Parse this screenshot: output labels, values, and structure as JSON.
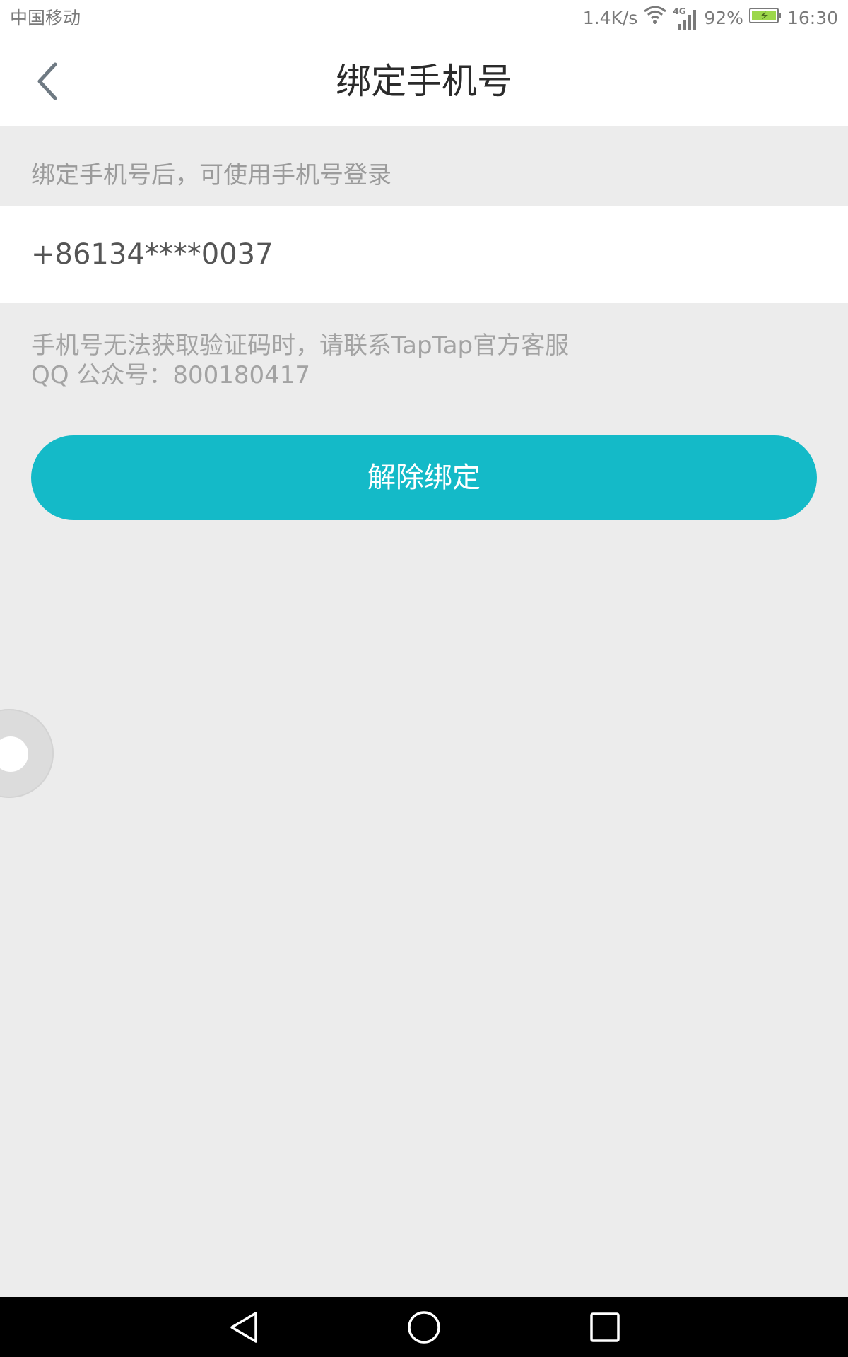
{
  "status_bar": {
    "carrier": "中国移动",
    "speed": "1.4K/s",
    "network_type": "4G",
    "battery": "92%",
    "time": "16:30",
    "icons": [
      "wifi-icon",
      "signal-icon",
      "battery-icon"
    ]
  },
  "header": {
    "title": "绑定手机号",
    "back_icon": "back-arrow-icon"
  },
  "hint": "绑定手机号后，可使用手机号登录",
  "phone": {
    "number": "+86134****0037"
  },
  "support": {
    "line1": "手机号无法获取验证码时，请联系TapTap官方客服",
    "line2": "QQ 公众号：800180417"
  },
  "unbind_button": {
    "label": "解除绑定"
  },
  "colors": {
    "accent": "#14bac8",
    "background": "#ececec",
    "surface": "#ffffff",
    "battery_fill": "#9cd74a"
  },
  "nav_bar": {
    "icons": [
      "nav-back-icon",
      "nav-home-icon",
      "nav-recents-icon"
    ]
  }
}
